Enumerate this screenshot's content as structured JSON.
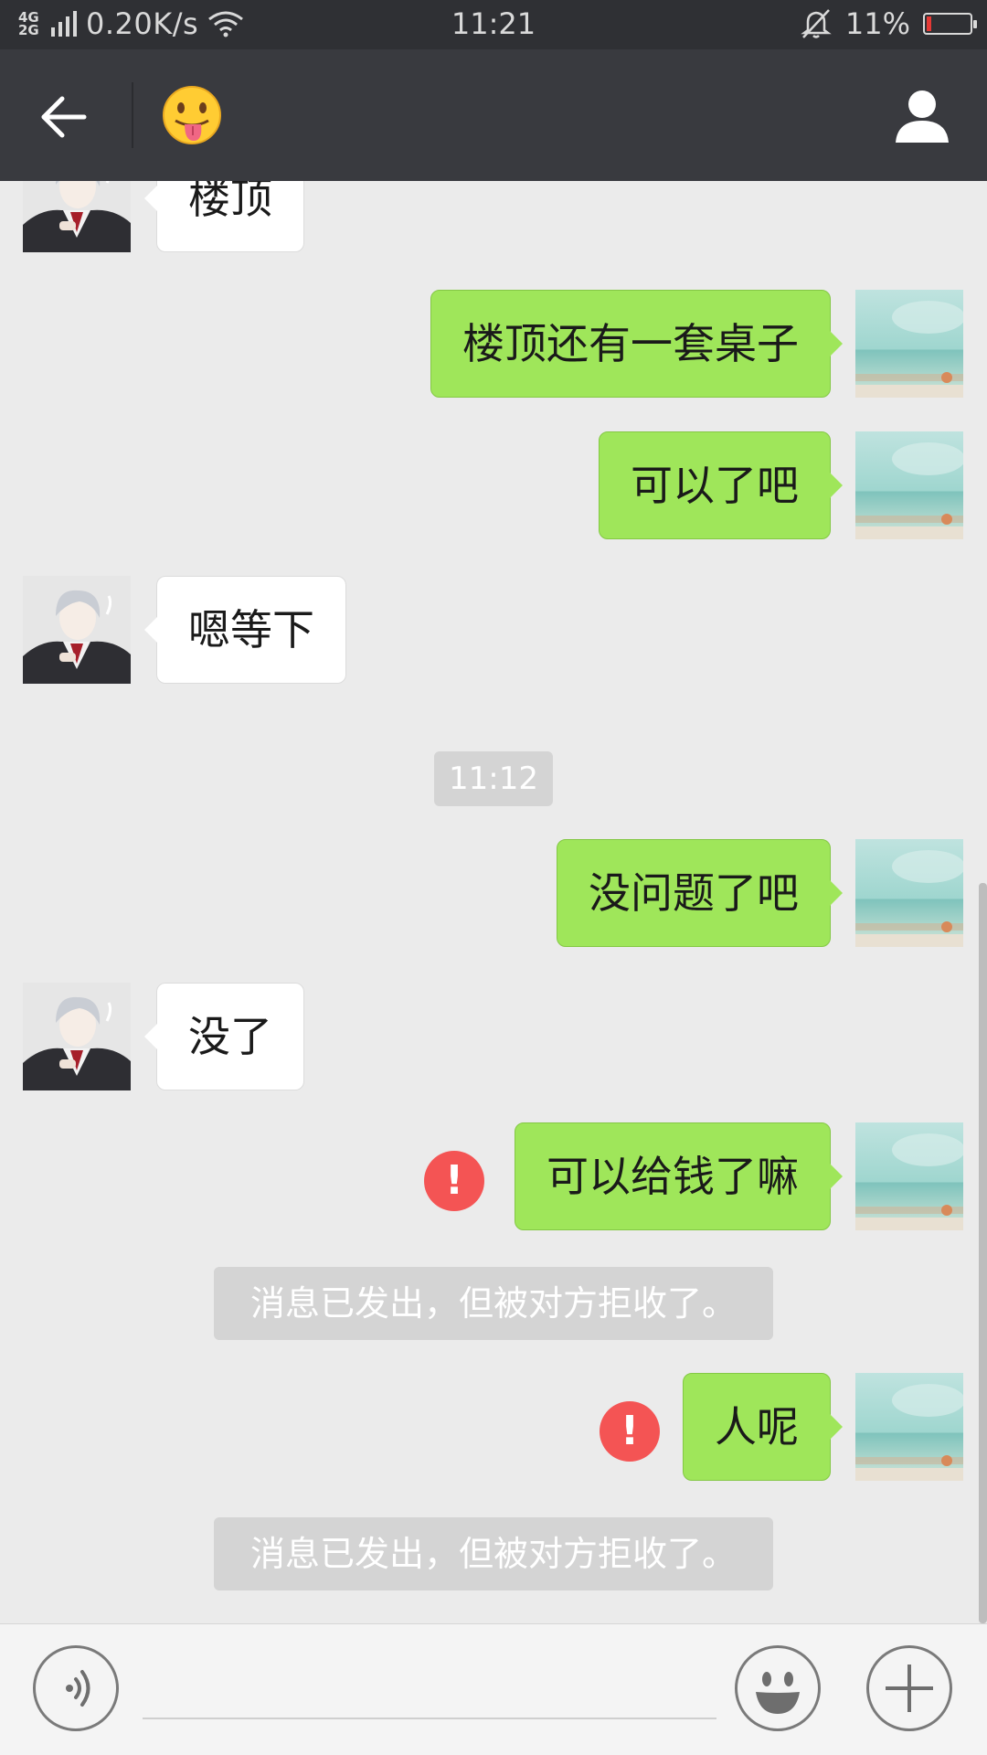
{
  "status_bar": {
    "network_type": "4G 2G",
    "net_speed": "0.20K/s",
    "time": "11:21",
    "battery": "11%",
    "battery_level": 0.11,
    "icons": [
      "signal-icon",
      "wifi-icon",
      "mute-bell-icon",
      "battery-icon"
    ]
  },
  "header": {
    "title_emoji": "😛",
    "icons": [
      "back-arrow-icon",
      "tongue-emoji-icon",
      "profile-icon"
    ]
  },
  "messages": [
    {
      "kind": "message",
      "side": "in",
      "text": "楼顶"
    },
    {
      "kind": "message",
      "side": "out",
      "text": "楼顶还有一套桌子"
    },
    {
      "kind": "message",
      "side": "out",
      "text": "可以了吧"
    },
    {
      "kind": "message",
      "side": "in",
      "text": "嗯等下"
    },
    {
      "kind": "timestamp",
      "text": "11:12"
    },
    {
      "kind": "message",
      "side": "out",
      "text": "没问题了吧"
    },
    {
      "kind": "message",
      "side": "in",
      "text": "没了"
    },
    {
      "kind": "message",
      "side": "out",
      "text": "可以给钱了嘛",
      "failed": true,
      "error_icon": "!"
    },
    {
      "kind": "system",
      "text": "消息已发出，但被对方拒收了。"
    },
    {
      "kind": "message",
      "side": "out",
      "text": "人呢",
      "failed": true,
      "error_icon": "!"
    },
    {
      "kind": "system",
      "text": "消息已发出，但被对方拒收了。"
    }
  ],
  "input_bar": {
    "placeholder": "",
    "icons": [
      "voice-icon",
      "emoji-icon",
      "plus-icon"
    ]
  },
  "colors": {
    "status_bar_bg": "#2f3034",
    "title_bar_bg": "#393a3f",
    "chat_bg": "#ebebeb",
    "outgoing_bubble": "#9fe65a",
    "incoming_bubble": "#ffffff",
    "error_red": "#f45454",
    "system_note_bg": "#d4d4d4"
  }
}
